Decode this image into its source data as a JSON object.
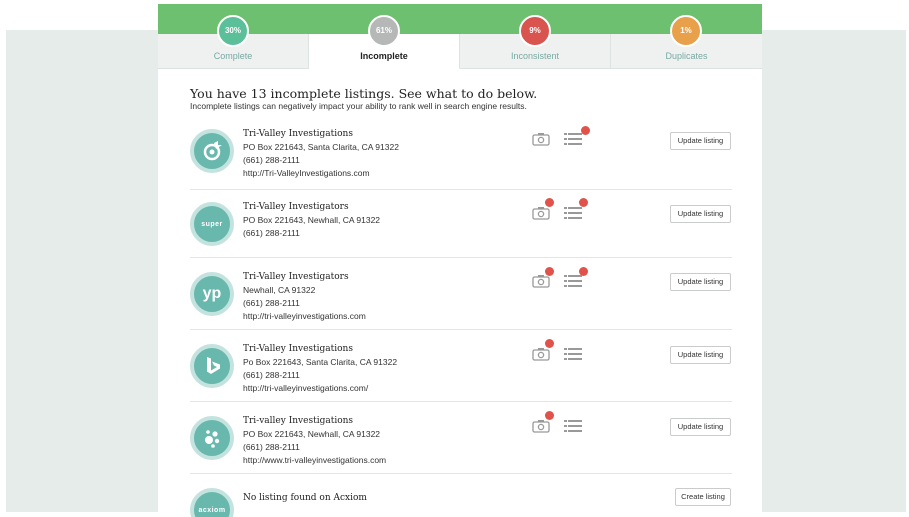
{
  "tabs": [
    {
      "label": "Complete",
      "percent": "30%",
      "color": "#5bbf9a"
    },
    {
      "label": "Incomplete",
      "percent": "61%",
      "color": "#b5b8b7"
    },
    {
      "label": "Inconsistent",
      "percent": "9%",
      "color": "#d9534f"
    },
    {
      "label": "Duplicates",
      "percent": "1%",
      "color": "#e8a04a"
    }
  ],
  "active_tab": "Incomplete",
  "headline": "You have 13 incomplete listings. See what to do below.",
  "subline": "Incomplete listings can negatively impact your ability to rank well in search engine results.",
  "listings": [
    {
      "source_icon": "target-logo-icon",
      "name": "Tri-Valley Investigations",
      "lines": [
        "PO Box 221643, Santa Clarita, CA 91322",
        "(661) 288-2111",
        "http://Tri-ValleyInvestigations.com"
      ],
      "photo_alert": false,
      "details_alert": true,
      "button": "Update listing"
    },
    {
      "source_icon": "super-pages-logo-icon",
      "logo_text": "super",
      "name": "Tri-Valley Investigators",
      "lines": [
        "PO Box 221643, Newhall, CA 91322",
        "(661) 288-2111"
      ],
      "photo_alert": true,
      "details_alert": true,
      "button": "Update listing"
    },
    {
      "source_icon": "yp-logo-icon",
      "logo_text": "yp",
      "name": "Tri-Valley Investigators",
      "lines": [
        "Newhall, CA 91322",
        "(661) 288-2111",
        "http://tri-valleyinvestigations.com"
      ],
      "photo_alert": true,
      "details_alert": true,
      "button": "Update listing"
    },
    {
      "source_icon": "bing-logo-icon",
      "name": "Tri-Valley Investigations",
      "lines": [
        "Po Box 221643, Santa Clarita, CA 91322",
        "(661) 288-2111",
        "http://tri-valleyinvestigations.com/"
      ],
      "photo_alert": true,
      "details_alert": false,
      "button": "Update listing"
    },
    {
      "source_icon": "yelp-like-logo-icon",
      "name": "Tri-valley Investigations",
      "lines": [
        "PO Box 221643, Newhall, CA 91322",
        "(661) 288-2111",
        "http://www.tri-valleyinvestigations.com"
      ],
      "photo_alert": true,
      "details_alert": false,
      "button": "Update listing"
    },
    {
      "source_icon": "acxiom-logo-icon",
      "logo_text": "acxiom",
      "name": "No listing found on Acxiom",
      "lines": [],
      "photo_alert": false,
      "details_alert": false,
      "button": "Create listing"
    }
  ],
  "colors": {
    "green_bar": "#6cc06f",
    "logo_bg": "#68b8ae",
    "alert_dot": "#e0524a"
  }
}
